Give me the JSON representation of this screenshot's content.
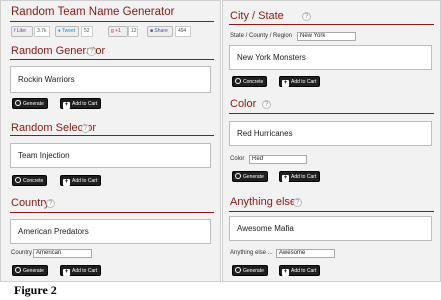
{
  "header": {
    "title": "Random Team Name Generator"
  },
  "social": {
    "like": "Like",
    "like_count": "3.7k",
    "tweet": "Tweet",
    "tweet_count": "52",
    "plus": "+1",
    "plus_count": "12",
    "share": "Share",
    "share_count": "494"
  },
  "buttons": {
    "generate": "Generate",
    "concrete": "Concrete",
    "add": "Add to Cart"
  },
  "left": {
    "random_generator": {
      "title": "Random Generator",
      "result": "Rockin Warriors"
    },
    "random_selector": {
      "title": "Random Selector",
      "result": "Team Injection"
    },
    "country": {
      "title": "Country",
      "result": "American Predators",
      "label": "Country",
      "value": "American"
    }
  },
  "right": {
    "city": {
      "title": "City / State",
      "label": "State / County / Region",
      "value": "New York",
      "result": "New York Monsters"
    },
    "color": {
      "title": "Color",
      "result": "Red Hurricanes",
      "label": "Color",
      "value": "Red"
    },
    "anything": {
      "title": "Anything else",
      "result": "Awesome Mafia",
      "label": "Anything else ...",
      "value": "Awesome"
    }
  },
  "caption": "Figure 2"
}
